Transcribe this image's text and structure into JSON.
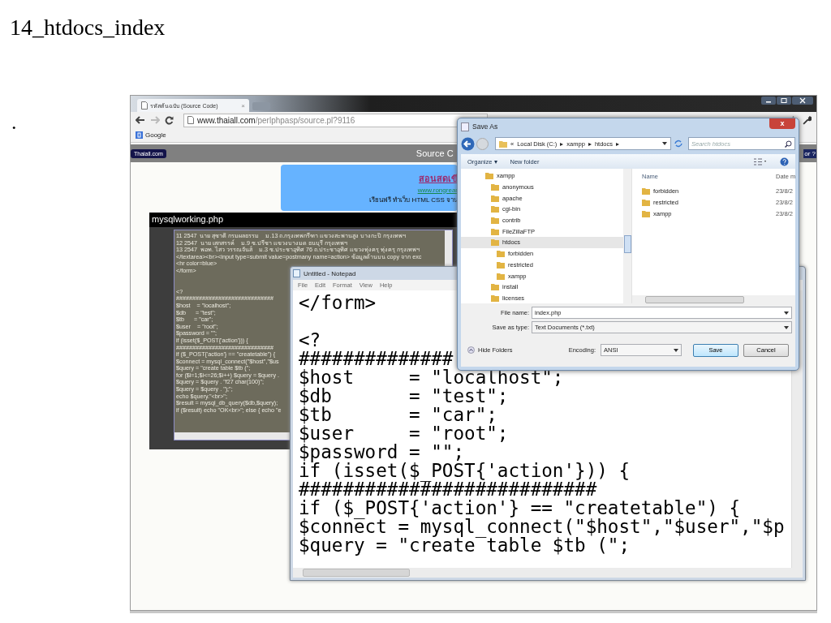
{
  "slide_title": "14_htdocs_index",
  "bullet": ".",
  "browser": {
    "tab": {
      "title": "รหัสต้นฉบับ (Source Code)",
      "close": "×"
    },
    "url_host": "www.thaiall.com",
    "url_path": "/perlphpasp/source.pl?9116",
    "bookmarks": [
      {
        "label": "Google"
      }
    ],
    "site_logo": "Thaiall.com",
    "header_title": "Source C",
    "header_right": "or ?",
    "banner": {
      "heading": "สอนสดเขี",
      "link": "www.rongrear",
      "subtitle": "เรียนฟรี ทำเว็บ HTML CSS จาน"
    },
    "code_panel": {
      "title": "mysqlworking.php",
      "text": "11 2547  นาย สุชาติ กรมผลธรรม    ม.13 ถ.กรุงเทพกรีฑา แขวงสะพานสูง บางกะปิ กรุงเทพฯ\n12 2547  นาย เสกสรรค์    ม.9 ซ.ปรีชา แขวงบางมด ธนบุรี กรุงเทพฯ\n13 2547  พอท. ไสว วรรณจันส์    ม.3 ซ.ประชาอุทิศ 76 ถ.ประชาอุทิศ แขวงทุ่งครุ ทุ่งครุ กรุงเทพฯ\n</textarea><br><input type=submit value=postmany name=action> ข้อมูลด้านบน copy จาก exc\n<hr color=blue>\n</form>\n\n\n<?\n##############################\n$host    = \"localhost\";\n$db      = \"test\";\n$tb      = \"car\";\n$user    = \"root\";\n$password = \"\";\nif (isset($_POST{'action'})) {\n##############################\nif ($_POST{'action'} == \"createtable\") {\n$connect = mysql_connect(\"$host\",\"$us\n$query = \"create table $tb (\";\nfor ($i=1;$i<=26;$i++) $query = $query .\n$query = $query . \"f27 char(100)\";\n$query = $query . \");\";\necho $query.\"<br>\";\n$result = mysql_db_query($db,$query);\nif ($result) echo \"OK<br>\"; else { echo \"e"
    }
  },
  "notepad": {
    "title": "Untitled - Notepad",
    "menu": [
      "File",
      "Edit",
      "Format",
      "View",
      "Help"
    ],
    "text": "</form>\n\n<?\n##############\n$host     = \"localhost\";\n$db       = \"test\";\n$tb       = \"car\";\n$user     = \"root\";\n$password = \"\";\nif (isset($_POST{'action'})) {\n###########################\nif ($_POST{'action'} == \"createtable\") {\n$connect = mysql_connect(\"$host\",\"$user\",\"$p\n$query = \"create table $tb (\";"
  },
  "save_dialog": {
    "title": "Save As",
    "close": "x",
    "breadcrumb": [
      "«",
      "Local Disk (C:)",
      "▸",
      "xampp",
      "▸",
      "htdocs",
      "▸"
    ],
    "search": {
      "placeholder": "Search htdocs"
    },
    "toolbar": [
      "Organize ▾",
      "New folder"
    ],
    "tree": [
      {
        "label": "xampp",
        "selected": false,
        "children": [
          {
            "label": "anonymous",
            "selected": false
          },
          {
            "label": "apache",
            "selected": false
          },
          {
            "label": "cgi-bin",
            "selected": false
          },
          {
            "label": "contrib",
            "selected": false
          },
          {
            "label": "FileZillaFTP",
            "selected": false
          },
          {
            "label": "htdocs",
            "selected": true,
            "children": [
              {
                "label": "forbidden",
                "selected": false
              },
              {
                "label": "restricted",
                "selected": false
              },
              {
                "label": "xampp",
                "selected": false
              }
            ]
          },
          {
            "label": "install",
            "selected": false
          },
          {
            "label": "licenses",
            "selected": false
          }
        ]
      }
    ],
    "columns": [
      "Name",
      "Date m"
    ],
    "files": [
      {
        "name": "forbidden",
        "date": "23/8/2",
        "selected": false
      },
      {
        "name": "restricted",
        "date": "23/8/2",
        "selected": false
      },
      {
        "name": "xampp",
        "date": "23/8/2",
        "selected": false
      }
    ],
    "file_name": {
      "label": "File name:",
      "value": "index.php"
    },
    "save_type": {
      "label": "Save as type:",
      "value": "Text Documents (*.txt)"
    },
    "hide_folders": "Hide Folders",
    "encoding": {
      "label": "Encoding:",
      "value": "ANSI"
    },
    "buttons": [
      "Save",
      "Cancel"
    ]
  }
}
